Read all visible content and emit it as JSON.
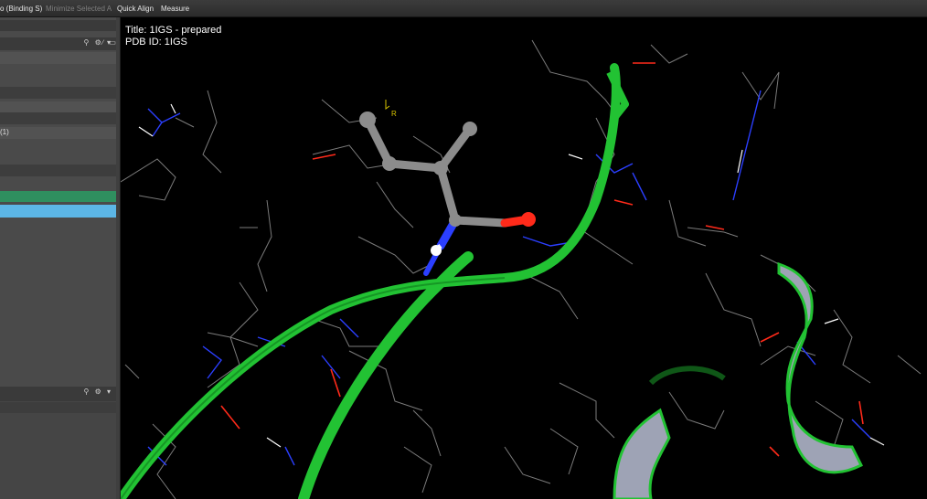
{
  "toolbar": {
    "items": [
      {
        "label": "o (Binding S)",
        "enabled": true
      },
      {
        "label": "Minimize Selected A",
        "enabled": false
      },
      {
        "label": "Quick Align",
        "enabled": true
      },
      {
        "label": "Measure",
        "enabled": true
      }
    ]
  },
  "left_panel": {
    "row_label": "(1)",
    "header_icons": "⚲ ⚙ ▾",
    "header_icons_2": "∕ ▭",
    "bottom_header_icons": "⚲ ⚙ ▾"
  },
  "viewport": {
    "title_line": "Title: 1IGS - prepared",
    "pdb_line": "PDB ID: 1IGS",
    "atom_label": "R"
  },
  "colors": {
    "ribbon_green": "#22c233",
    "carbon_gray": "#9a9a9a",
    "nitrogen_blue": "#2b3fff",
    "oxygen_red": "#ff2a1a",
    "selection_blue": "#5cb6e6",
    "row_green": "#2f8f5f"
  }
}
